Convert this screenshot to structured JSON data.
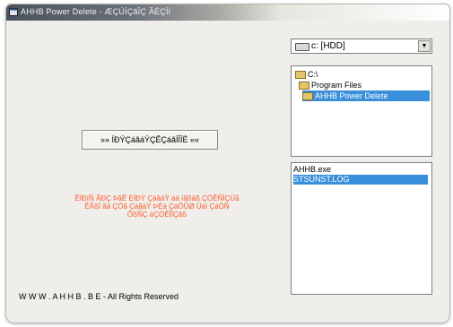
{
  "window": {
    "title": "AHHB Power Delete - ÆÇÚÌÇãÎÇ ÃÈÇÏí"
  },
  "drive_select": {
    "value": "c: [HDD]",
    "icon": "drive-icon"
  },
  "directory_list": {
    "items": [
      {
        "label": "C:\\"
      },
      {
        "label": "Program Files"
      },
      {
        "label": "AHHB Power Delete"
      }
    ],
    "selected": "AHHB Power Delete"
  },
  "file_list": {
    "items": [
      {
        "label": "AHHB.exe"
      },
      {
        "label": "STSUNST.LOG"
      }
    ],
    "selected": "STSUNST.LOG"
  },
  "action_button": {
    "label": "»» ÍÐÝÇáãáÝÇÊÇáãÍÏÏÉ ««"
  },
  "warning": {
    "line1": "ÊÍÐíÑ ÅÐÇ ÞãÊ ÈÍÐÝ ÇáãáÝ áä íãßäß ÇÓÊÑÌÇÚå",
    "line2": "ÊÃßÏ ãä ÇÓã ÇáãáÝ ÞÈá ÇáÖÛØ Úáì ÇáÒÑ",
    "line3": "ÔßÑÇ áÇÓÊÎÏÇãß",
    "color": "#ff5a2a"
  },
  "footer": {
    "text": "W W W . A H H B . B E - All Rights Reserved"
  },
  "colors": {
    "selection": "#3a8fdb",
    "window_bg": "#efeeea"
  }
}
